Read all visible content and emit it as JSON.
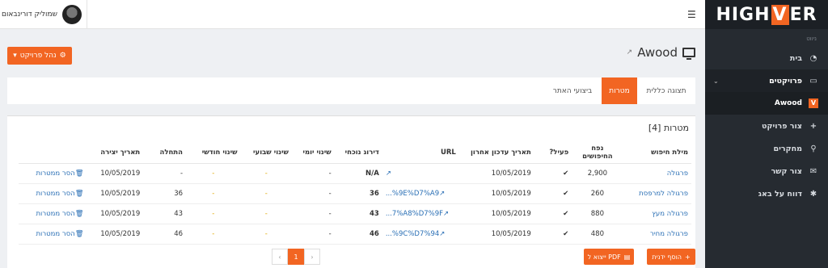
{
  "brand": {
    "logo_left": "HIGH",
    "logo_v": "V",
    "logo_right": "ER"
  },
  "sidebar": {
    "section_header": "ניווט",
    "items": [
      {
        "label": "בית",
        "icon": "dashboard-icon"
      },
      {
        "label": "פרויקטים",
        "icon": "monitor-icon"
      },
      {
        "label": "Awood",
        "icon": "project-v-icon"
      },
      {
        "label": "צור פרויקט",
        "icon": "plus-icon"
      },
      {
        "label": "מחקרים",
        "icon": "search-icon"
      },
      {
        "label": "צור קשר",
        "icon": "envelope-icon"
      },
      {
        "label": "דווח על באג",
        "icon": "bug-icon"
      }
    ]
  },
  "header": {
    "user_name": "שמוליק דורינבאום",
    "menu_icon": "hamburger-icon"
  },
  "page": {
    "title": "Awood",
    "manage_button": "נהל פרויקט",
    "tabs": [
      "תצוגה כללית",
      "מטרות",
      "ביצועי האתר"
    ],
    "panel_title": "מטרות [4]"
  },
  "table": {
    "headers": [
      "מילת חיפוש",
      "נפח החיפושים",
      "פעיל?",
      "תאריך עדכון אחרון",
      "URL",
      "דירוג נוכחי",
      "שינוי יומי",
      "שינוי שבועי",
      "שינוי חודשי",
      "התחלה",
      "תאריך יצירה",
      ""
    ],
    "rows": [
      {
        "keyword": "פרגולה",
        "volume": "2,900",
        "active": "✔",
        "updated": "10/05/2019",
        "url": "",
        "rank": "N/A",
        "daily": "-",
        "weekly": "-",
        "monthly": "-",
        "start": "-",
        "created": "10/05/2019",
        "remove": "הסר ממטרות"
      },
      {
        "keyword": "פרגולה למרפסת",
        "volume": "260",
        "active": "✔",
        "updated": "10/05/2019",
        "url": "...%9E%D7%A9",
        "rank": "36",
        "daily": "-",
        "weekly": "-",
        "monthly": "-",
        "start": "36",
        "created": "10/05/2019",
        "remove": "הסר ממטרות"
      },
      {
        "keyword": "פרגולה מעץ",
        "volume": "880",
        "active": "✔",
        "updated": "10/05/2019",
        "url": "...7%A8%D7%9F",
        "rank": "43",
        "daily": "-",
        "weekly": "-",
        "monthly": "-",
        "start": "43",
        "created": "10/05/2019",
        "remove": "הסר ממטרות"
      },
      {
        "keyword": "פרגולה מחיר",
        "volume": "480",
        "active": "✔",
        "updated": "10/05/2019",
        "url": "...%9C%D7%94",
        "rank": "46",
        "daily": "-",
        "weekly": "-",
        "monthly": "-",
        "start": "46",
        "created": "10/05/2019",
        "remove": "הסר ממטרות"
      }
    ]
  },
  "footer": {
    "add_button": "הוסף ידנית",
    "pdf_button": "ייצוא ל PDF",
    "page_current": "1",
    "prev": "‹",
    "next": "›"
  },
  "colors": {
    "accent": "#f26522",
    "sidebar_bg": "#262b31",
    "link": "#2a6fb5"
  }
}
